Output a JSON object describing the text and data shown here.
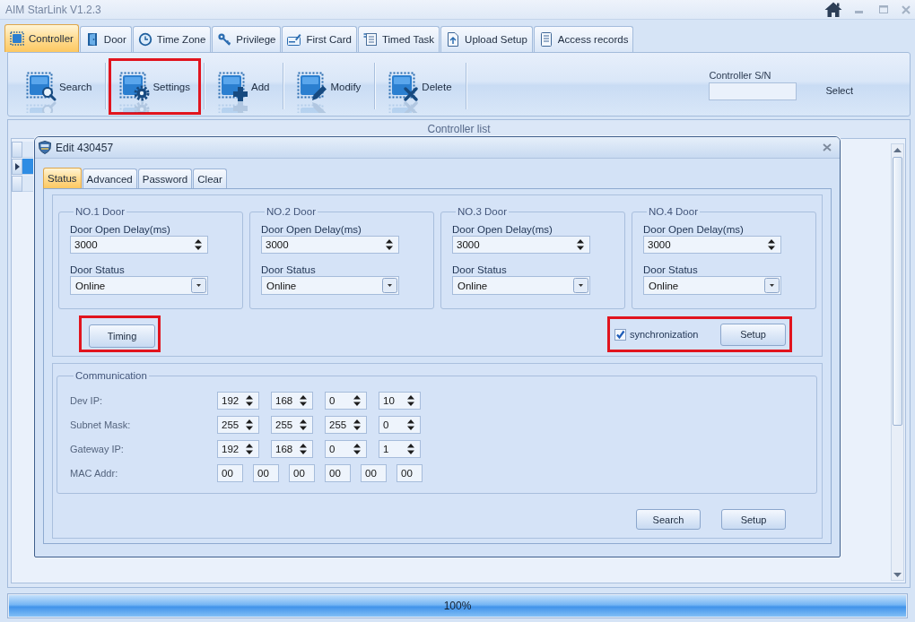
{
  "window": {
    "title": "AIM StarLink V1.2.3"
  },
  "tabs": [
    {
      "label": "Controller",
      "selected": true
    },
    {
      "label": "Door",
      "selected": false
    },
    {
      "label": "Time Zone",
      "selected": false
    },
    {
      "label": "Privilege",
      "selected": false
    },
    {
      "label": "First Card",
      "selected": false
    },
    {
      "label": "Timed Task",
      "selected": false
    },
    {
      "label": "Upload Setup",
      "selected": false
    },
    {
      "label": "Access records",
      "selected": false
    }
  ],
  "toolbar": {
    "items": [
      {
        "label": "Search",
        "highlighted": false
      },
      {
        "label": "Settings",
        "highlighted": true
      },
      {
        "label": "Add",
        "highlighted": false
      },
      {
        "label": "Modify",
        "highlighted": false
      },
      {
        "label": "Delete",
        "highlighted": false
      }
    ],
    "serial_label": "Controller S/N",
    "select_button": "Select"
  },
  "controller_list": {
    "title": "Controller list",
    "rows": [
      {
        "selected": false
      },
      {
        "selected": true
      },
      {
        "selected": false
      }
    ]
  },
  "dialog": {
    "title": "Edit 430457",
    "tabs": [
      {
        "label": "Status",
        "selected": true
      },
      {
        "label": "Advanced",
        "selected": false
      },
      {
        "label": "Password",
        "selected": false
      },
      {
        "label": "Clear",
        "selected": false
      }
    ],
    "doors": [
      {
        "title": "NO.1 Door",
        "delay_label": "Door Open Delay(ms)",
        "delay": "3000",
        "status_label": "Door Status",
        "status": "Online"
      },
      {
        "title": "NO.2 Door",
        "delay_label": "Door Open Delay(ms)",
        "delay": "3000",
        "status_label": "Door Status",
        "status": "Online"
      },
      {
        "title": "NO.3 Door",
        "delay_label": "Door Open Delay(ms)",
        "delay": "3000",
        "status_label": "Door Status",
        "status": "Online"
      },
      {
        "title": "NO.4 Door",
        "delay_label": "Door Open Delay(ms)",
        "delay": "3000",
        "status_label": "Door Status",
        "status": "Online"
      }
    ],
    "timing_button": {
      "label": "Timing",
      "highlighted": true
    },
    "synchronization": {
      "label": "synchronization",
      "checked": true,
      "button": "Setup",
      "highlighted": true
    },
    "communication": {
      "title": "Communication",
      "rows": [
        {
          "label": "Dev IP:",
          "kind": "spin",
          "values": [
            "192",
            "168",
            "0",
            "10"
          ]
        },
        {
          "label": "Subnet Mask:",
          "kind": "spin",
          "values": [
            "255",
            "255",
            "255",
            "0"
          ]
        },
        {
          "label": "Gateway IP:",
          "kind": "spin",
          "values": [
            "192",
            "168",
            "0",
            "1"
          ]
        },
        {
          "label": "MAC Addr:",
          "kind": "text",
          "values": [
            "00",
            "00",
            "00",
            "00",
            "00",
            "00"
          ]
        }
      ]
    },
    "buttons": [
      "Search",
      "Setup"
    ]
  },
  "progress": {
    "level": 1,
    "reading": "100%"
  }
}
